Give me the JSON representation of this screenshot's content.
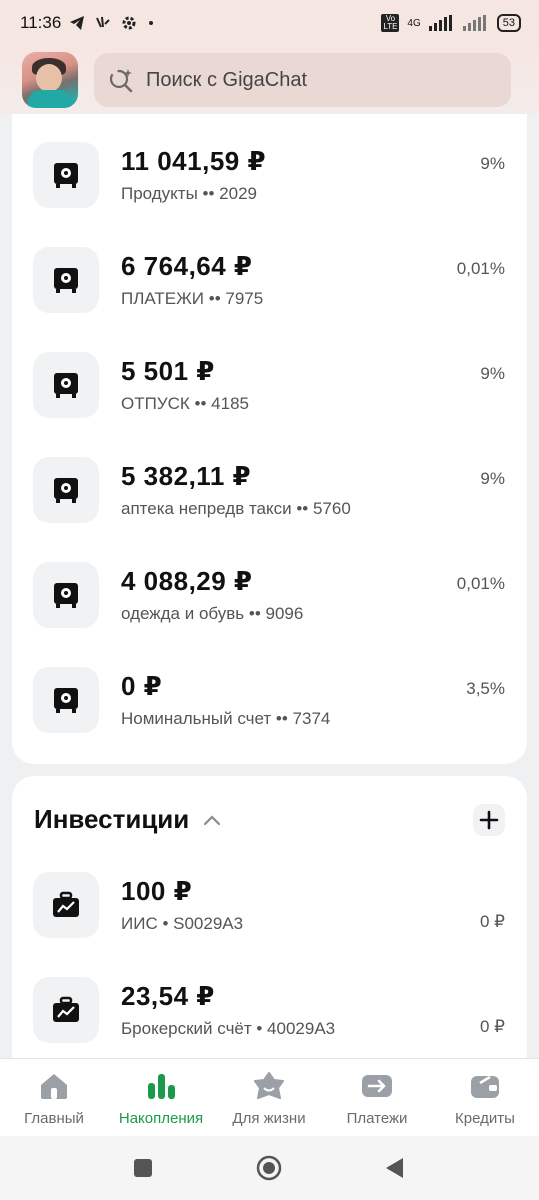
{
  "status": {
    "time": "11:36",
    "network": "4G",
    "volte": "Vo LTE",
    "battery": "53"
  },
  "search": {
    "placeholder": "Поиск с GigaChat"
  },
  "savings": [
    {
      "amount": "11 041,59 ₽",
      "name": "Продукты •• 2029",
      "rate": "9%"
    },
    {
      "amount": "6 764,64 ₽",
      "name": "ПЛАТЕЖИ •• 7975",
      "rate": "0,01%"
    },
    {
      "amount": "5 501 ₽",
      "name": "ОТПУСК •• 4185",
      "rate": "9%"
    },
    {
      "amount": "5 382,11 ₽",
      "name": "аптека непредв такси •• 5760",
      "rate": "9%"
    },
    {
      "amount": "4 088,29 ₽",
      "name": "одежда и обувь •• 9096",
      "rate": "0,01%"
    },
    {
      "amount": "0 ₽",
      "name": "Номинальный счет •• 7374",
      "rate": "3,5%"
    }
  ],
  "investments": {
    "title": "Инвестиции",
    "items": [
      {
        "amount": "100 ₽",
        "name": "ИИС • S0029A3",
        "value": "0 ₽"
      },
      {
        "amount": "23,54 ₽",
        "name": "Брокерский счёт • 40029A3",
        "value": "0 ₽"
      }
    ]
  },
  "nav": [
    {
      "label": "Главный",
      "icon": "home-icon"
    },
    {
      "label": "Накопления",
      "icon": "bar-chart-icon",
      "active": true
    },
    {
      "label": "Для жизни",
      "icon": "star-face-icon"
    },
    {
      "label": "Платежи",
      "icon": "arrow-transfer-icon"
    },
    {
      "label": "Кредиты",
      "icon": "wallet-icon"
    }
  ],
  "colors": {
    "accent": "#1a9a4a",
    "header_bg": "#f6e6e2"
  }
}
